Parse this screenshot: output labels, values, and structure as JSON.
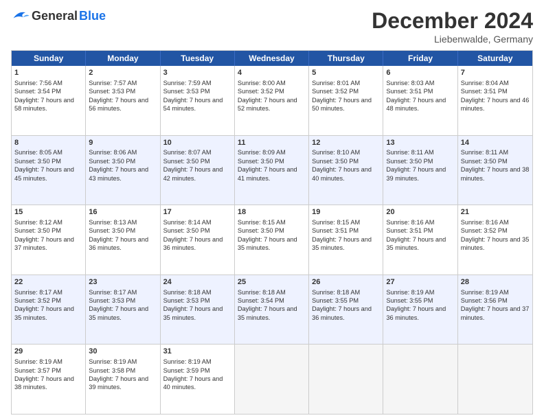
{
  "logo": {
    "general": "General",
    "blue": "Blue"
  },
  "title": "December 2024",
  "location": "Liebenwalde, Germany",
  "days_header": [
    "Sunday",
    "Monday",
    "Tuesday",
    "Wednesday",
    "Thursday",
    "Friday",
    "Saturday"
  ],
  "rows": [
    [
      {
        "day": "",
        "sunrise": "",
        "sunset": "",
        "daylight": "",
        "empty": true
      },
      {
        "day": "2",
        "sunrise": "Sunrise: 7:57 AM",
        "sunset": "Sunset: 3:53 PM",
        "daylight": "Daylight: 7 hours and 56 minutes."
      },
      {
        "day": "3",
        "sunrise": "Sunrise: 7:59 AM",
        "sunset": "Sunset: 3:53 PM",
        "daylight": "Daylight: 7 hours and 54 minutes."
      },
      {
        "day": "4",
        "sunrise": "Sunrise: 8:00 AM",
        "sunset": "Sunset: 3:52 PM",
        "daylight": "Daylight: 7 hours and 52 minutes."
      },
      {
        "day": "5",
        "sunrise": "Sunrise: 8:01 AM",
        "sunset": "Sunset: 3:52 PM",
        "daylight": "Daylight: 7 hours and 50 minutes."
      },
      {
        "day": "6",
        "sunrise": "Sunrise: 8:03 AM",
        "sunset": "Sunset: 3:51 PM",
        "daylight": "Daylight: 7 hours and 48 minutes."
      },
      {
        "day": "7",
        "sunrise": "Sunrise: 8:04 AM",
        "sunset": "Sunset: 3:51 PM",
        "daylight": "Daylight: 7 hours and 46 minutes."
      }
    ],
    [
      {
        "day": "1",
        "sunrise": "Sunrise: 7:56 AM",
        "sunset": "Sunset: 3:54 PM",
        "daylight": "Daylight: 7 hours and 58 minutes."
      },
      {
        "day": "",
        "sunrise": "",
        "sunset": "",
        "daylight": "",
        "empty": true
      },
      {
        "day": "",
        "sunrise": "",
        "sunset": "",
        "daylight": "",
        "empty": true
      },
      {
        "day": "",
        "sunrise": "",
        "sunset": "",
        "daylight": "",
        "empty": true
      },
      {
        "day": "",
        "sunrise": "",
        "sunset": "",
        "daylight": "",
        "empty": true
      },
      {
        "day": "",
        "sunrise": "",
        "sunset": "",
        "daylight": "",
        "empty": true
      },
      {
        "day": "",
        "sunrise": "",
        "sunset": "",
        "daylight": "",
        "empty": true
      }
    ],
    [
      {
        "day": "8",
        "sunrise": "Sunrise: 8:05 AM",
        "sunset": "Sunset: 3:50 PM",
        "daylight": "Daylight: 7 hours and 45 minutes."
      },
      {
        "day": "9",
        "sunrise": "Sunrise: 8:06 AM",
        "sunset": "Sunset: 3:50 PM",
        "daylight": "Daylight: 7 hours and 43 minutes."
      },
      {
        "day": "10",
        "sunrise": "Sunrise: 8:07 AM",
        "sunset": "Sunset: 3:50 PM",
        "daylight": "Daylight: 7 hours and 42 minutes."
      },
      {
        "day": "11",
        "sunrise": "Sunrise: 8:09 AM",
        "sunset": "Sunset: 3:50 PM",
        "daylight": "Daylight: 7 hours and 41 minutes."
      },
      {
        "day": "12",
        "sunrise": "Sunrise: 8:10 AM",
        "sunset": "Sunset: 3:50 PM",
        "daylight": "Daylight: 7 hours and 40 minutes."
      },
      {
        "day": "13",
        "sunrise": "Sunrise: 8:11 AM",
        "sunset": "Sunset: 3:50 PM",
        "daylight": "Daylight: 7 hours and 39 minutes."
      },
      {
        "day": "14",
        "sunrise": "Sunrise: 8:11 AM",
        "sunset": "Sunset: 3:50 PM",
        "daylight": "Daylight: 7 hours and 38 minutes."
      }
    ],
    [
      {
        "day": "15",
        "sunrise": "Sunrise: 8:12 AM",
        "sunset": "Sunset: 3:50 PM",
        "daylight": "Daylight: 7 hours and 37 minutes."
      },
      {
        "day": "16",
        "sunrise": "Sunrise: 8:13 AM",
        "sunset": "Sunset: 3:50 PM",
        "daylight": "Daylight: 7 hours and 36 minutes."
      },
      {
        "day": "17",
        "sunrise": "Sunrise: 8:14 AM",
        "sunset": "Sunset: 3:50 PM",
        "daylight": "Daylight: 7 hours and 36 minutes."
      },
      {
        "day": "18",
        "sunrise": "Sunrise: 8:15 AM",
        "sunset": "Sunset: 3:50 PM",
        "daylight": "Daylight: 7 hours and 35 minutes."
      },
      {
        "day": "19",
        "sunrise": "Sunrise: 8:15 AM",
        "sunset": "Sunset: 3:51 PM",
        "daylight": "Daylight: 7 hours and 35 minutes."
      },
      {
        "day": "20",
        "sunrise": "Sunrise: 8:16 AM",
        "sunset": "Sunset: 3:51 PM",
        "daylight": "Daylight: 7 hours and 35 minutes."
      },
      {
        "day": "21",
        "sunrise": "Sunrise: 8:16 AM",
        "sunset": "Sunset: 3:52 PM",
        "daylight": "Daylight: 7 hours and 35 minutes."
      }
    ],
    [
      {
        "day": "22",
        "sunrise": "Sunrise: 8:17 AM",
        "sunset": "Sunset: 3:52 PM",
        "daylight": "Daylight: 7 hours and 35 minutes."
      },
      {
        "day": "23",
        "sunrise": "Sunrise: 8:17 AM",
        "sunset": "Sunset: 3:53 PM",
        "daylight": "Daylight: 7 hours and 35 minutes."
      },
      {
        "day": "24",
        "sunrise": "Sunrise: 8:18 AM",
        "sunset": "Sunset: 3:53 PM",
        "daylight": "Daylight: 7 hours and 35 minutes."
      },
      {
        "day": "25",
        "sunrise": "Sunrise: 8:18 AM",
        "sunset": "Sunset: 3:54 PM",
        "daylight": "Daylight: 7 hours and 35 minutes."
      },
      {
        "day": "26",
        "sunrise": "Sunrise: 8:18 AM",
        "sunset": "Sunset: 3:55 PM",
        "daylight": "Daylight: 7 hours and 36 minutes."
      },
      {
        "day": "27",
        "sunrise": "Sunrise: 8:19 AM",
        "sunset": "Sunset: 3:55 PM",
        "daylight": "Daylight: 7 hours and 36 minutes."
      },
      {
        "day": "28",
        "sunrise": "Sunrise: 8:19 AM",
        "sunset": "Sunset: 3:56 PM",
        "daylight": "Daylight: 7 hours and 37 minutes."
      }
    ],
    [
      {
        "day": "29",
        "sunrise": "Sunrise: 8:19 AM",
        "sunset": "Sunset: 3:57 PM",
        "daylight": "Daylight: 7 hours and 38 minutes."
      },
      {
        "day": "30",
        "sunrise": "Sunrise: 8:19 AM",
        "sunset": "Sunset: 3:58 PM",
        "daylight": "Daylight: 7 hours and 39 minutes."
      },
      {
        "day": "31",
        "sunrise": "Sunrise: 8:19 AM",
        "sunset": "Sunset: 3:59 PM",
        "daylight": "Daylight: 7 hours and 40 minutes."
      },
      {
        "day": "",
        "sunrise": "",
        "sunset": "",
        "daylight": "",
        "empty": true
      },
      {
        "day": "",
        "sunrise": "",
        "sunset": "",
        "daylight": "",
        "empty": true
      },
      {
        "day": "",
        "sunrise": "",
        "sunset": "",
        "daylight": "",
        "empty": true
      },
      {
        "day": "",
        "sunrise": "",
        "sunset": "",
        "daylight": "",
        "empty": true
      }
    ]
  ]
}
